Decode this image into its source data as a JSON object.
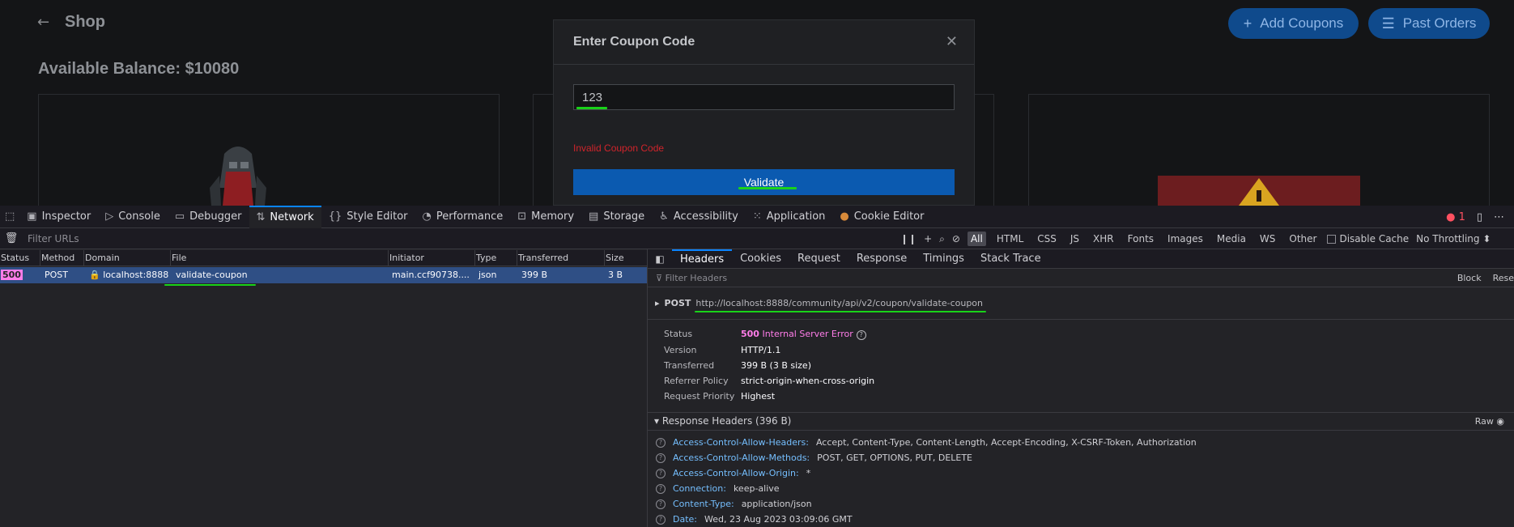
{
  "shop": {
    "title": "Shop",
    "balance": "Available Balance: $10080",
    "add_coupons": "Add Coupons",
    "past_orders": "Past Orders"
  },
  "modal": {
    "title": "Enter Coupon Code",
    "input_value": "123",
    "error": "Invalid Coupon Code",
    "validate": "Validate"
  },
  "devtools": {
    "tabs": [
      "Inspector",
      "Console",
      "Debugger",
      "Network",
      "Style Editor",
      "Performance",
      "Memory",
      "Storage",
      "Accessibility",
      "Application",
      "Cookie Editor"
    ],
    "error_count": "1",
    "filter_placeholder": "Filter URLs",
    "type_filters": [
      "All",
      "HTML",
      "CSS",
      "JS",
      "XHR",
      "Fonts",
      "Images",
      "Media",
      "WS",
      "Other"
    ],
    "disable_cache": "Disable Cache",
    "throttling": "No Throttling",
    "columns": [
      "Status",
      "Method",
      "Domain",
      "File",
      "Initiator",
      "Type",
      "Transferred",
      "Size"
    ],
    "request": {
      "status": "500",
      "method": "POST",
      "domain": "localhost:8888",
      "file": "validate-coupon",
      "initiator": "main.ccf90738....",
      "type": "json",
      "transferred": "399 B",
      "size": "3 B"
    },
    "detail_tabs": [
      "Headers",
      "Cookies",
      "Request",
      "Response",
      "Timings",
      "Stack Trace"
    ],
    "filter_headers": "Filter Headers",
    "block": "Block",
    "resend": "Rese",
    "post_method": "POST",
    "post_url": "http://localhost:8888/community/api/v2/coupon/validate-coupon",
    "summary": {
      "status_label": "Status",
      "status_code": "500",
      "status_text": "Internal Server Error",
      "version_label": "Version",
      "version": "HTTP/1.1",
      "transferred_label": "Transferred",
      "transferred": "399 B (3 B size)",
      "referrer_label": "Referrer Policy",
      "referrer": "strict-origin-when-cross-origin",
      "priority_label": "Request Priority",
      "priority": "Highest"
    },
    "response_headers_title": "Response Headers (396 B)",
    "raw": "Raw",
    "response_headers": [
      {
        "name": "Access-Control-Allow-Headers:",
        "value": "Accept, Content-Type, Content-Length, Accept-Encoding, X-CSRF-Token, Authorization"
      },
      {
        "name": "Access-Control-Allow-Methods:",
        "value": "POST, GET, OPTIONS, PUT, DELETE"
      },
      {
        "name": "Access-Control-Allow-Origin:",
        "value": "*"
      },
      {
        "name": "Connection:",
        "value": "keep-alive"
      },
      {
        "name": "Content-Type:",
        "value": "application/json"
      },
      {
        "name": "Date:",
        "value": "Wed, 23 Aug 2023 03:09:06 GMT"
      }
    ]
  }
}
